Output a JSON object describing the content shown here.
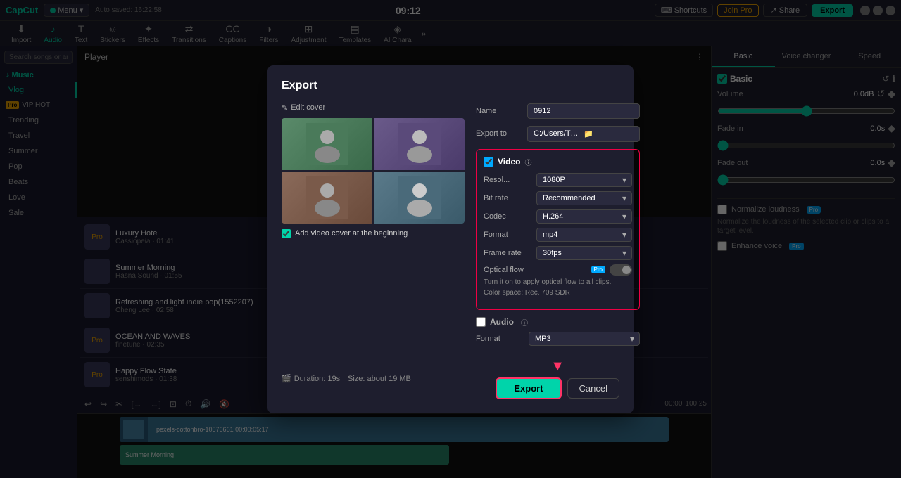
{
  "app": {
    "name": "CapCut",
    "autosave": "Auto saved: 16:22:58",
    "time": "09:12",
    "menu_label": "Menu"
  },
  "toolbar": {
    "tools": [
      {
        "id": "import",
        "label": "Import",
        "icon": "⬇"
      },
      {
        "id": "audio",
        "label": "Audio",
        "icon": "♪",
        "active": true
      },
      {
        "id": "text",
        "label": "Text",
        "icon": "T"
      },
      {
        "id": "stickers",
        "label": "Stickers",
        "icon": "☺"
      },
      {
        "id": "effects",
        "label": "Effects",
        "icon": "✦"
      },
      {
        "id": "transitions",
        "label": "Transitions",
        "icon": "⇄"
      },
      {
        "id": "captions",
        "label": "Captions",
        "icon": "CC"
      },
      {
        "id": "filters",
        "label": "Filters",
        "icon": "◑"
      },
      {
        "id": "adjustment",
        "label": "Adjustment",
        "icon": "⊞"
      },
      {
        "id": "templates",
        "label": "Templates",
        "icon": "▤"
      },
      {
        "id": "ai_chara",
        "label": "AI Chara",
        "icon": "◈"
      }
    ],
    "shortcuts_label": "Shortcuts",
    "joinpro_label": "Join Pro",
    "share_label": "Share",
    "export_label": "Export"
  },
  "sidebar": {
    "search_placeholder": "Search songs or artists",
    "music_section": "♪ Music",
    "items": [
      {
        "label": "Vlog",
        "active": true
      },
      {
        "label": "VIP HOT",
        "pro": true
      },
      {
        "label": "Trending"
      },
      {
        "label": "Travel"
      },
      {
        "label": "Summer"
      },
      {
        "label": "Pop"
      },
      {
        "label": "Beats"
      },
      {
        "label": "Love"
      },
      {
        "label": "Sale"
      }
    ],
    "tracks": [
      {
        "title": "Luxury Hotel",
        "artist": "Cassiopeia",
        "duration": "01:41",
        "pro": true
      },
      {
        "title": "Summer Morning",
        "artist": "Hasna Sound",
        "duration": "01:55"
      },
      {
        "title": "Refreshing and light indie pop(1552207)",
        "artist": "Cheng Lee",
        "duration": "02:58"
      },
      {
        "title": "OCEAN AND WAVES",
        "artist": "finetune",
        "duration": "02:35",
        "pro": true
      },
      {
        "title": "Happy Flow State",
        "artist": "senshimods",
        "duration": "01:38",
        "pro": true
      }
    ]
  },
  "player": {
    "label": "Player"
  },
  "right_panel": {
    "tabs": [
      "Basic",
      "Voice changer",
      "Speed"
    ],
    "active_tab": "Basic",
    "basic": {
      "section_title": "Basic",
      "volume_label": "Volume",
      "volume_value": "0.0dB",
      "fade_in_label": "Fade in",
      "fade_in_value": "0.0s",
      "fade_out_label": "Fade out",
      "fade_out_value": "0.0s",
      "normalize_label": "Normalize loudness",
      "normalize_desc": "Normalize the loudness of the selected clip or clips to a target level.",
      "enhance_label": "Enhance voice"
    }
  },
  "export_modal": {
    "title": "Export",
    "edit_cover": "Edit cover",
    "add_cover_label": "Add video cover at the beginning",
    "name_label": "Name",
    "name_value": "0912",
    "export_to_label": "Export to",
    "export_to_value": "C:/Users/TOPGUS/De...",
    "video": {
      "label": "Video",
      "checked": true,
      "resolution_label": "Resol...",
      "resolution_value": "1080P",
      "bitrate_label": "Bit rate",
      "bitrate_value": "Recommended",
      "codec_label": "Codec",
      "codec_value": "H.264",
      "format_label": "Format",
      "format_value": "mp4",
      "framerate_label": "Frame rate",
      "framerate_value": "30fps",
      "optical_flow_label": "Optical flow",
      "optical_flow_desc": "Turn it on to apply optical flow to all clips.",
      "color_space": "Color space: Rec. 709 SDR"
    },
    "audio": {
      "label": "Audio",
      "checked": false,
      "format_label": "Format",
      "format_value": "MP3"
    },
    "footer": {
      "duration": "Duration: 19s",
      "size": "Size: about 19 MB",
      "export_btn": "Export",
      "cancel_btn": "Cancel"
    }
  },
  "timeline": {
    "duration_label": "00:00",
    "end_label": "100:25",
    "track1_label": "pexels-cottonbro-10576661  00:00:05:17",
    "track2_label": "Summer Morning"
  }
}
